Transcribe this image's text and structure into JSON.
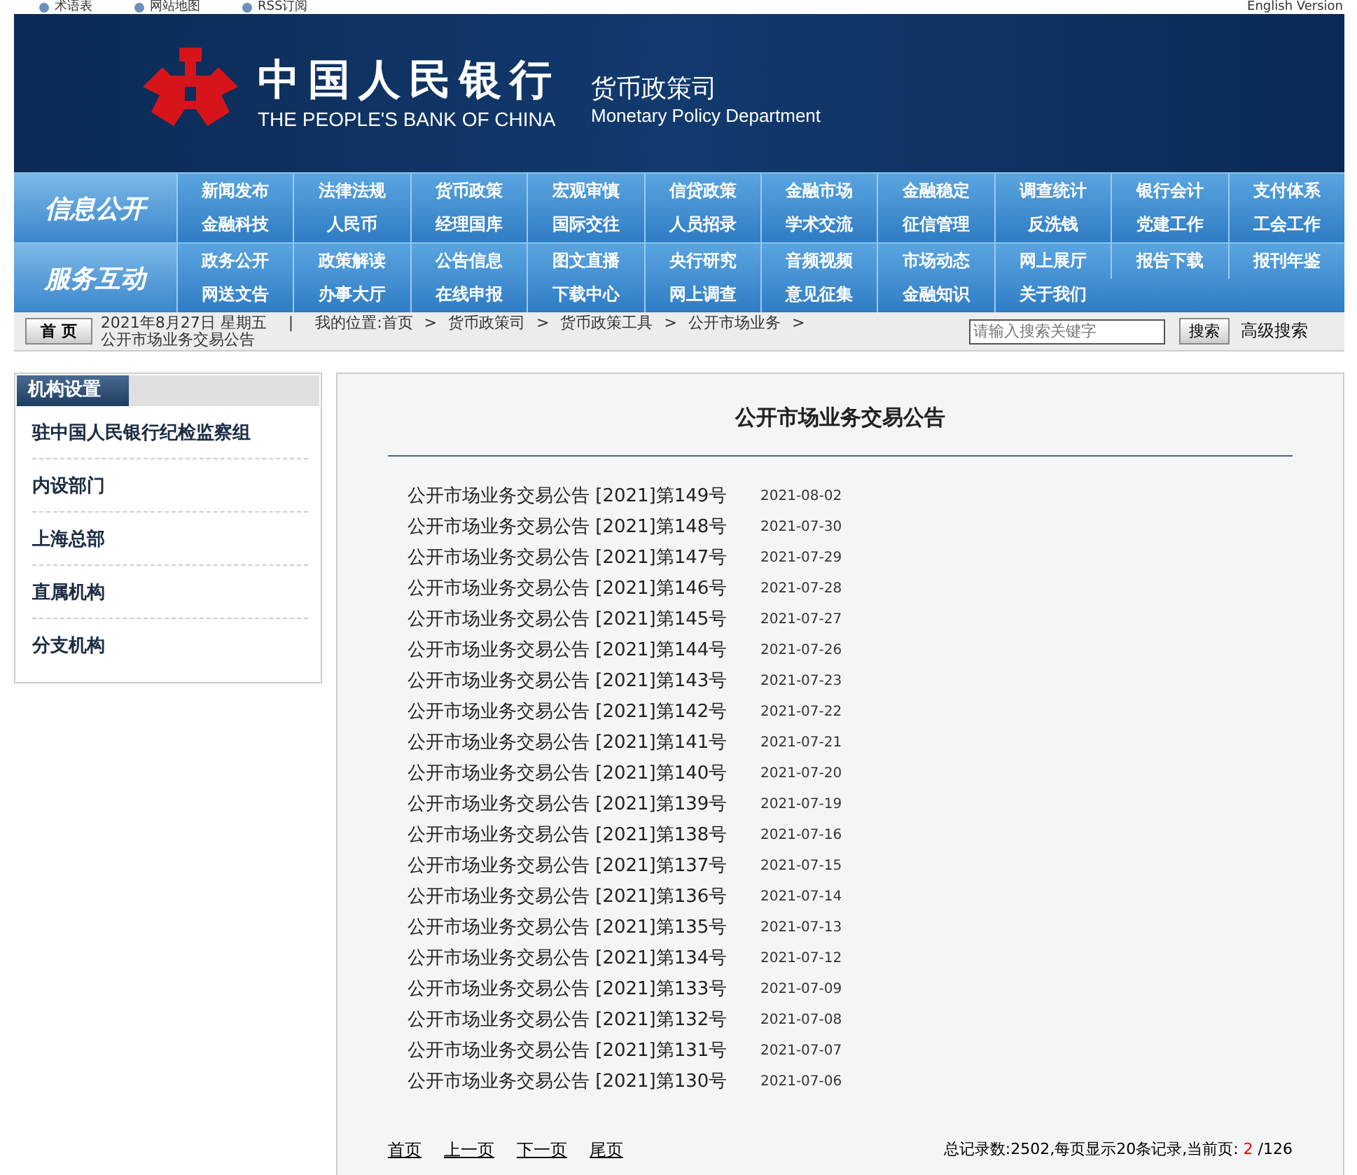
{
  "top_links": [
    {
      "label": "术语表"
    },
    {
      "label": "网站地图"
    },
    {
      "label": "RSS订阅"
    }
  ],
  "english_link": "English Version",
  "banner": {
    "name_cn": "中国人民银行",
    "name_en": "THE PEOPLE'S BANK OF CHINA",
    "dept_cn": "货币政策司",
    "dept_en": "Monetary Policy Department"
  },
  "nav_groups": [
    {
      "title": "信息公开",
      "rows": [
        [
          "新闻发布",
          "法律法规",
          "货币政策",
          "宏观审慎",
          "信贷政策",
          "金融市场",
          "金融稳定",
          "调查统计",
          "银行会计",
          "支付体系"
        ],
        [
          "金融科技",
          "人民币",
          "经理国库",
          "国际交往",
          "人员招录",
          "学术交流",
          "征信管理",
          "反洗钱",
          "党建工作",
          "工会工作"
        ]
      ]
    },
    {
      "title": "服务互动",
      "rows": [
        [
          "政务公开",
          "政策解读",
          "公告信息",
          "图文直播",
          "央行研究",
          "音频视频",
          "市场动态",
          "网上展厅",
          "报告下载",
          "报刊年鉴"
        ],
        [
          "网送文告",
          "办事大厅",
          "在线申报",
          "下载中心",
          "网上调查",
          "意见征集",
          "金融知识",
          "关于我们"
        ]
      ]
    }
  ],
  "breadcrumb": {
    "home_button": "首 页",
    "date": "2021年8月27日 星期五",
    "divider": "|",
    "location_label": "我的位置:",
    "items": [
      {
        "kind": "link",
        "text": "首页"
      },
      {
        "kind": "sep",
        "text": ">"
      },
      {
        "kind": "link",
        "text": "货币政策司"
      },
      {
        "kind": "sep",
        "text": ">"
      },
      {
        "kind": "link",
        "text": "货币政策工具"
      },
      {
        "kind": "sep",
        "text": ">"
      },
      {
        "kind": "link",
        "text": "公开市场业务"
      },
      {
        "kind": "sep",
        "text": ">"
      },
      {
        "kind": "link",
        "text": "公开市场业务交易公告"
      }
    ]
  },
  "search": {
    "placeholder": "请输入搜索关键字",
    "button": "搜索",
    "advanced": "高级搜索"
  },
  "sidebar": {
    "title": "机构设置",
    "items": [
      "驻中国人民银行纪检监察组",
      "内设部门",
      "上海总部",
      "直属机构",
      "分支机构"
    ]
  },
  "content": {
    "title": "公开市场业务交易公告",
    "rows": [
      {
        "title": "公开市场业务交易公告 [2021]第149号",
        "date": "2021-08-02"
      },
      {
        "title": "公开市场业务交易公告 [2021]第148号",
        "date": "2021-07-30"
      },
      {
        "title": "公开市场业务交易公告 [2021]第147号",
        "date": "2021-07-29"
      },
      {
        "title": "公开市场业务交易公告 [2021]第146号",
        "date": "2021-07-28"
      },
      {
        "title": "公开市场业务交易公告 [2021]第145号",
        "date": "2021-07-27"
      },
      {
        "title": "公开市场业务交易公告 [2021]第144号",
        "date": "2021-07-26"
      },
      {
        "title": "公开市场业务交易公告 [2021]第143号",
        "date": "2021-07-23"
      },
      {
        "title": "公开市场业务交易公告 [2021]第142号",
        "date": "2021-07-22"
      },
      {
        "title": "公开市场业务交易公告 [2021]第141号",
        "date": "2021-07-21"
      },
      {
        "title": "公开市场业务交易公告 [2021]第140号",
        "date": "2021-07-20"
      },
      {
        "title": "公开市场业务交易公告 [2021]第139号",
        "date": "2021-07-19"
      },
      {
        "title": "公开市场业务交易公告 [2021]第138号",
        "date": "2021-07-16"
      },
      {
        "title": "公开市场业务交易公告 [2021]第137号",
        "date": "2021-07-15"
      },
      {
        "title": "公开市场业务交易公告 [2021]第136号",
        "date": "2021-07-14"
      },
      {
        "title": "公开市场业务交易公告 [2021]第135号",
        "date": "2021-07-13"
      },
      {
        "title": "公开市场业务交易公告 [2021]第134号",
        "date": "2021-07-12"
      },
      {
        "title": "公开市场业务交易公告 [2021]第133号",
        "date": "2021-07-09"
      },
      {
        "title": "公开市场业务交易公告 [2021]第132号",
        "date": "2021-07-08"
      },
      {
        "title": "公开市场业务交易公告 [2021]第131号",
        "date": "2021-07-07"
      },
      {
        "title": "公开市场业务交易公告 [2021]第130号",
        "date": "2021-07-06"
      }
    ],
    "pagination": {
      "links": [
        "首页",
        "上一页",
        "下一页",
        "尾页"
      ],
      "summary": "总记录数:2502,每页显示20条记录,当前页:",
      "current_page": "2",
      "total_pages": "/126"
    }
  }
}
